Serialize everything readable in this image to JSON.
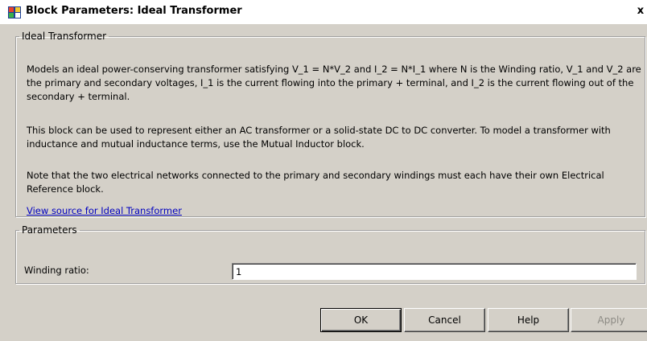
{
  "window": {
    "title": "Block Parameters: Ideal Transformer",
    "close_glyph": "x",
    "icon": "simulink-block-icon"
  },
  "description": {
    "legend": "Ideal Transformer",
    "paragraph1": "Models an ideal power-conserving transformer satisfying V_1 = N*V_2 and I_2 = N*I_1 where N is the Winding ratio, V_1 and V_2 are the primary and secondary voltages, I_1 is the current flowing into the primary + terminal, and I_2 is the current flowing out of the secondary + terminal.",
    "paragraph2": "This block can be used to represent either an AC transformer or a solid-state DC to DC converter. To model a transformer with inductance and mutual inductance terms, use the Mutual Inductor block.",
    "paragraph3": "Note that the two electrical networks connected to the primary and secondary windings must each have their own Electrical Reference block.",
    "link": "View source for Ideal Transformer"
  },
  "parameters": {
    "legend": "Parameters",
    "winding_label": "Winding ratio:",
    "winding_value": "1"
  },
  "buttons": {
    "ok": "OK",
    "cancel": "Cancel",
    "help": "Help",
    "apply": "Apply"
  },
  "colors": {
    "dialog_bg": "#d4d0c8",
    "link": "#0000c0",
    "disabled_text": "#8c8a84"
  }
}
